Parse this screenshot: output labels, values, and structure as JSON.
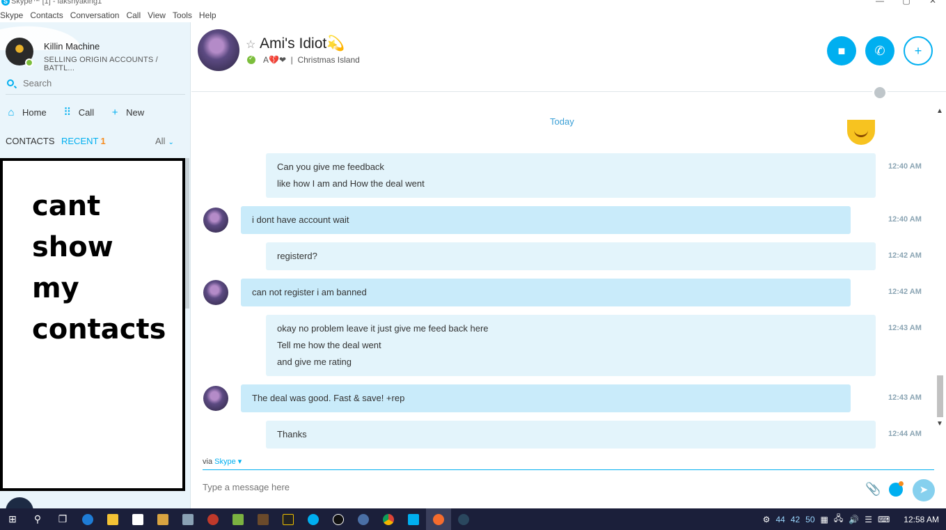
{
  "window": {
    "title": "Skype™ [1] - lakshyaking1",
    "minimize": "—",
    "maximize": "▢",
    "close": "✕"
  },
  "menu": [
    "Skype",
    "Contacts",
    "Conversation",
    "Call",
    "View",
    "Tools",
    "Help"
  ],
  "profile": {
    "name": "Killin Machine",
    "mood": "SELLING ORIGIN ACCOUNTS / BATTL..."
  },
  "search": {
    "placeholder": "Search"
  },
  "nav": {
    "home": "Home",
    "call": "Call",
    "new": "New"
  },
  "tabs": {
    "contacts": "CONTACTS",
    "recent": "RECENT",
    "recent_count": "1",
    "filter": "All"
  },
  "overlay_text": "cant\nshow\nmy\ncontacts",
  "conversation": {
    "title": "Ami's Idiot💫",
    "status": "A💔❤",
    "location": "Christmas Island",
    "day_separator": "Today",
    "messages": [
      {
        "from": "me",
        "lines": [
          "Can you give me feedback",
          "like how I am and How the deal went"
        ],
        "time": "12:40 AM"
      },
      {
        "from": "them",
        "lines": [
          "i dont have account wait"
        ],
        "time": "12:40 AM"
      },
      {
        "from": "me",
        "lines": [
          "registerd?"
        ],
        "time": "12:42 AM"
      },
      {
        "from": "them",
        "lines": [
          "can not register i am banned"
        ],
        "time": "12:42 AM"
      },
      {
        "from": "me",
        "lines": [
          "okay no problem leave it just give me feed back here",
          "Tell me how the deal went",
          "and give me rating"
        ],
        "time": "12:43 AM"
      },
      {
        "from": "them",
        "lines": [
          "The deal was good. Fast & save! +rep"
        ],
        "time": "12:43 AM"
      },
      {
        "from": "me",
        "lines": [
          "Thanks"
        ],
        "time": "12:44 AM"
      }
    ],
    "via_prefix": "via",
    "via_service": "Skype",
    "composer_placeholder": "Type a message here"
  },
  "taskbar": {
    "tray_numbers": [
      "44",
      "42",
      "50"
    ],
    "clock": "12:58 AM"
  },
  "colors": {
    "accent": "#00aff0",
    "sidebar_bg": "#eaf5fb",
    "bubble_me": "#e3f4fb",
    "bubble_them": "#c9ebfa",
    "online": "#7cbe3c",
    "taskbar": "#1b1f3a"
  },
  "icons": {
    "video_call": "video-camera-icon",
    "audio_call": "phone-icon",
    "add_people": "add-person-icon",
    "attach": "paperclip-icon",
    "emoticon": "smiley-icon",
    "send": "send-arrow-icon",
    "search": "search-icon",
    "home": "home-icon",
    "call": "dialpad-icon",
    "new": "plus-icon"
  }
}
